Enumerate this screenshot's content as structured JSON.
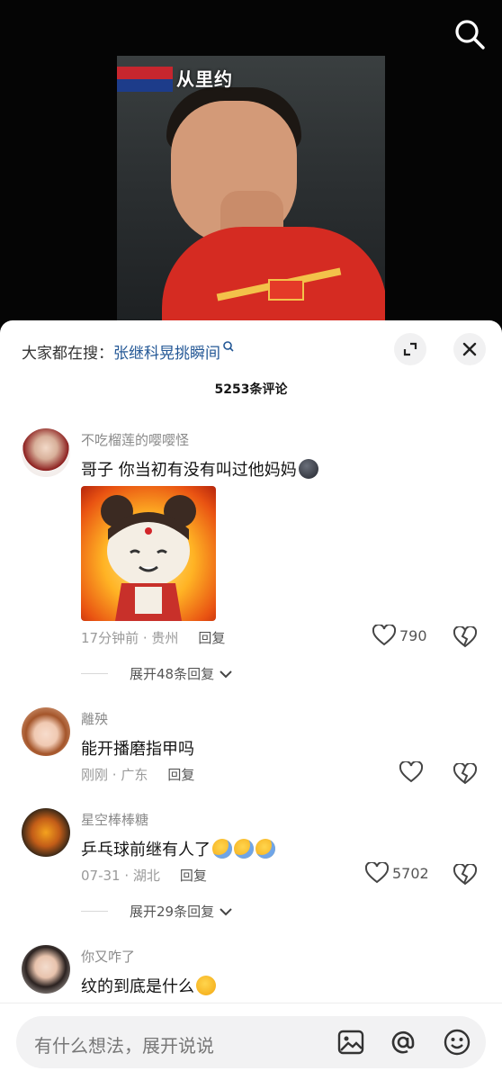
{
  "video": {
    "overlay_text": "从里约"
  },
  "comments_panel": {
    "hot_search_label": "大家都在搜：",
    "hot_search_term": "张继科晃挑瞬间",
    "comment_count": "5253条评论"
  },
  "comments": [
    {
      "username": "不吃榴莲的嘤嘤怪",
      "text": "哥子  你当初有没有叫过他妈妈",
      "time": "17分钟前",
      "location": "贵州",
      "reply_label": "回复",
      "likes": "790",
      "expand_replies": "展开48条回复"
    },
    {
      "username": "離殃",
      "text": "能开播磨指甲吗",
      "time": "刚刚",
      "location": "广东",
      "reply_label": "回复",
      "likes": ""
    },
    {
      "username": "星空棒棒糖",
      "text": "乒乓球前继有人了",
      "time": "07-31",
      "location": "湖北",
      "reply_label": "回复",
      "likes": "5702",
      "expand_replies": "展开29条回复"
    },
    {
      "username": "你又咋了",
      "text": "纹的到底是什么",
      "time": "",
      "location": "",
      "reply_label": ""
    }
  ],
  "input": {
    "placeholder": "有什么想法，展开说说"
  },
  "colors": {
    "link": "#245896",
    "jersey": "#d52b22"
  },
  "icons": [
    "search-icon",
    "expand-icon",
    "close-icon",
    "heart-icon",
    "broken-heart-icon",
    "chevron-down-icon",
    "image-icon",
    "at-icon",
    "emoji-icon"
  ]
}
